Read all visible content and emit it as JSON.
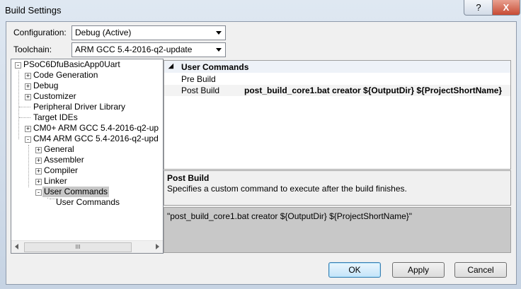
{
  "window": {
    "title": "Build Settings"
  },
  "titlebar": {
    "help_glyph": "?",
    "close_glyph": "X"
  },
  "form": {
    "config_label": "Configuration:",
    "config_value": "Debug (Active)",
    "toolchain_label": "Toolchain:",
    "toolchain_value": "ARM GCC 5.4-2016-q2-update"
  },
  "tree": {
    "nodes": [
      {
        "label": "PSoC6DfuBasicApp0Uart",
        "expander": "-"
      },
      {
        "label": "Code Generation",
        "expander": "+"
      },
      {
        "label": "Debug",
        "expander": "+"
      },
      {
        "label": "Customizer",
        "expander": "+"
      },
      {
        "label": "Peripheral Driver Library"
      },
      {
        "label": "Target IDEs"
      },
      {
        "label": "CM0+ ARM GCC 5.4-2016-q2-up",
        "expander": "+"
      },
      {
        "label": "CM4 ARM GCC 5.4-2016-q2-upd",
        "expander": "-"
      },
      {
        "label": "General",
        "expander": "+"
      },
      {
        "label": "Assembler",
        "expander": "+"
      },
      {
        "label": "Compiler",
        "expander": "+"
      },
      {
        "label": "Linker",
        "expander": "+"
      },
      {
        "label": "User Commands",
        "expander": "-",
        "selected": true
      },
      {
        "label": "User Commands"
      }
    ],
    "scroll_thumb_glyph": "III"
  },
  "properties": {
    "category": "User Commands",
    "collapse_glyph": "◢",
    "rows": [
      {
        "key": "Pre Build",
        "value": ""
      },
      {
        "key": "Post Build",
        "value": "post_build_core1.bat creator ${OutputDir} ${ProjectShortName}"
      }
    ]
  },
  "description": {
    "title": "Post Build",
    "text": "Specifies a custom command to execute after the build finishes."
  },
  "command_preview": "\"post_build_core1.bat creator ${OutputDir} ${ProjectShortName}\"",
  "buttons": {
    "ok": "OK",
    "apply": "Apply",
    "cancel": "Cancel"
  }
}
